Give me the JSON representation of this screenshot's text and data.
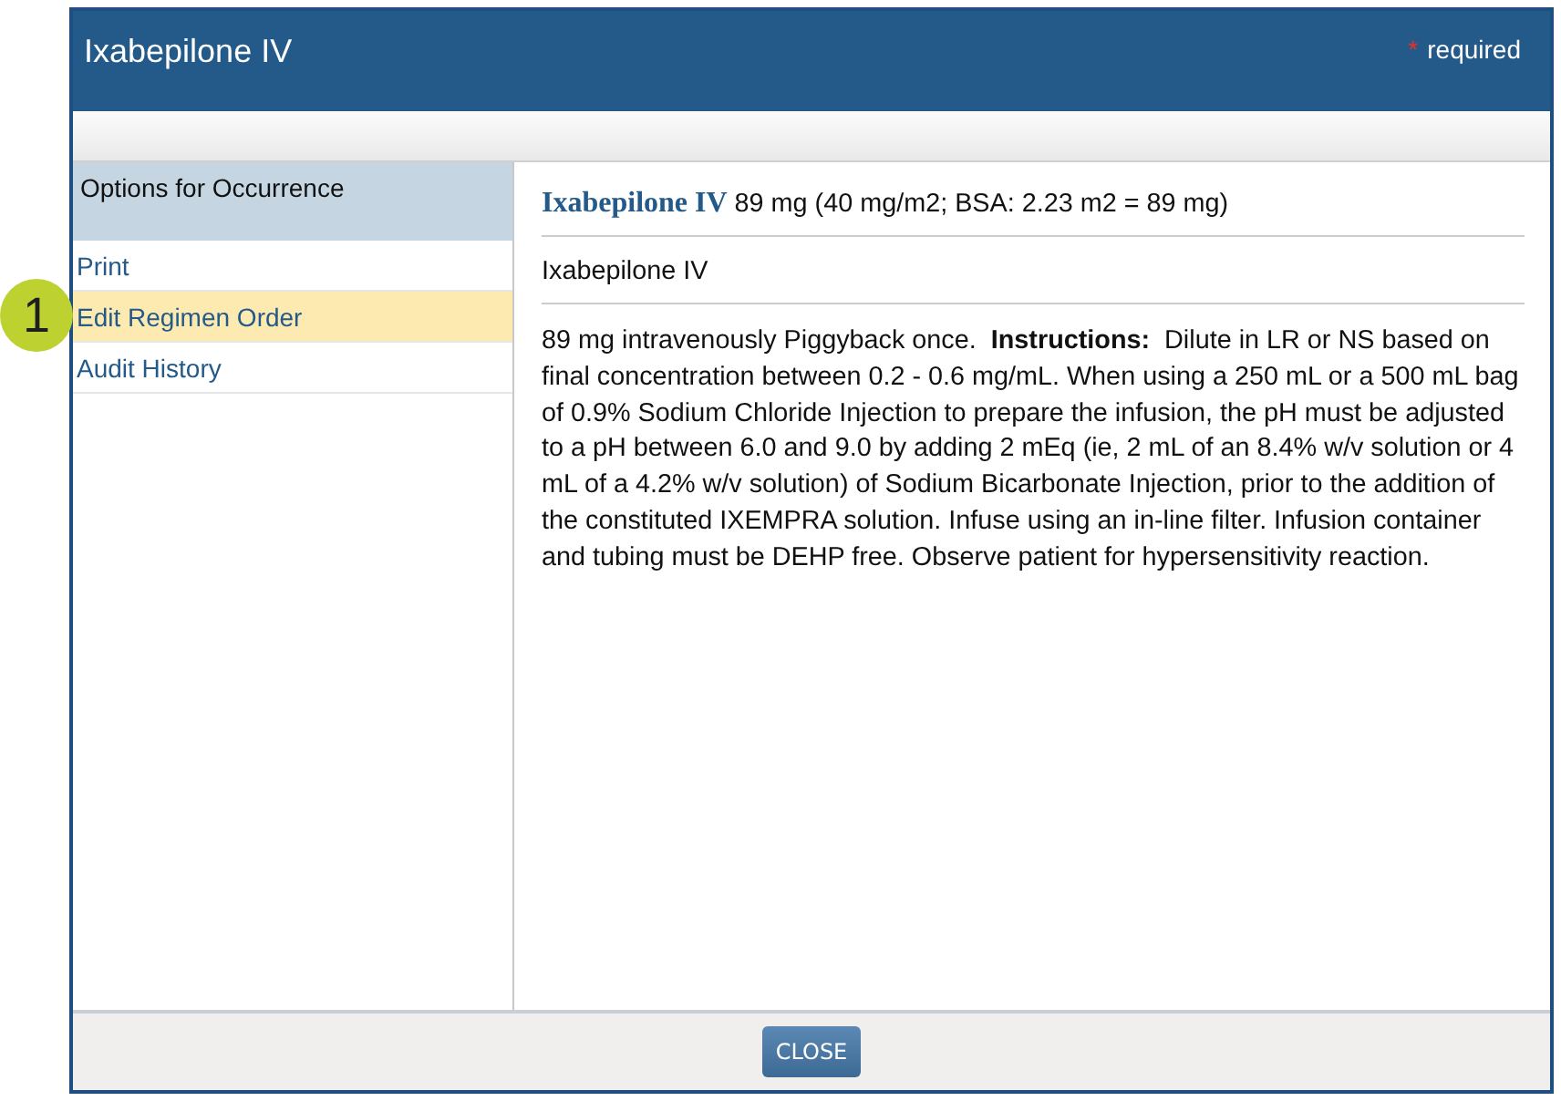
{
  "dialog": {
    "title": "Ixabepilone IV",
    "required_note": {
      "marker": "*",
      "label": "required"
    }
  },
  "options_panel": {
    "heading": "Options for Occurrence",
    "items": [
      {
        "label": "Print",
        "selected": false
      },
      {
        "label": "Edit Regimen Order",
        "selected": true
      },
      {
        "label": "Audit History",
        "selected": false
      }
    ]
  },
  "callout_badge": "1",
  "order_detail": {
    "drug_name": "Ixabepilone IV",
    "dose_summary": "89 mg (40 mg/m2; BSA: 2.23 m2 = 89 mg)",
    "product": "Ixabepilone IV",
    "instructions": "89 mg intravenously Piggyback once.  **Instructions:**  Dilute in LR or NS based on final concentration between 0.2 - 0.6 mg/mL. When using a 250 mL or a 500 mL bag of 0.9% Sodium Chloride Injection to prepare the infusion, the pH must be adjusted to a pH between 6.0 and 9.0 by adding 2 mEq (ie, 2 mL of an 8.4% w/v solution or 4 mL of a 4.2% w/v solution) of Sodium Bicarbonate Injection, prior to the addition of the constituted IXEMPRA solution. Infuse using an in-line filter. Infusion container and tubing must be DEHP free. Observe patient for hypersensitivity reaction."
  },
  "footer": {
    "buttons": [
      "CLOSE"
    ]
  }
}
